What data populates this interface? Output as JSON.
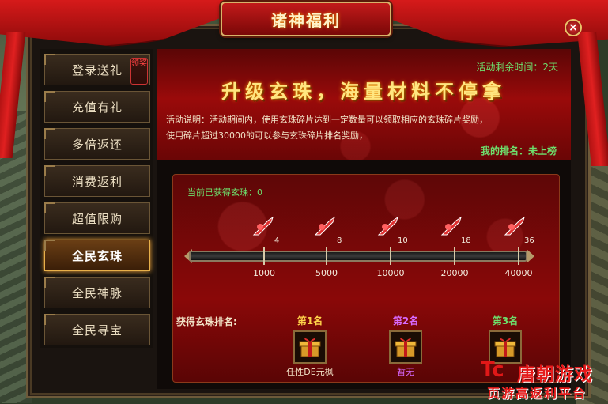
{
  "window": {
    "title": "诸神福利",
    "close_label": "×"
  },
  "sidebar": {
    "items": [
      {
        "label": "登录送礼",
        "badge": "领奖",
        "active": false
      },
      {
        "label": "充值有礼",
        "active": false
      },
      {
        "label": "多倍返还",
        "active": false
      },
      {
        "label": "消费返利",
        "active": false
      },
      {
        "label": "超值限购",
        "active": false
      },
      {
        "label": "全民玄珠",
        "active": true
      },
      {
        "label": "全民神脉",
        "active": false
      },
      {
        "label": "全民寻宝",
        "active": false
      }
    ]
  },
  "banner": {
    "time_left": "活动剩余时间：2天",
    "headline": "升级玄珠，海量材料不停拿",
    "desc_line1": "活动说明：活动期间内，使用玄珠碎片达到一定数量可以领取相应的玄珠碎片奖励，",
    "desc_line2": "使用碎片超过30000的可以参与玄珠碎片排名奖励，",
    "my_rank_label": "我的排名：",
    "my_rank_value": "未上榜"
  },
  "progress": {
    "obtained": "当前已获得玄珠：0",
    "milestones": [
      {
        "threshold": "1000",
        "reward_count": "4"
      },
      {
        "threshold": "5000",
        "reward_count": "8"
      },
      {
        "threshold": "10000",
        "reward_count": "10"
      },
      {
        "threshold": "20000",
        "reward_count": "18"
      },
      {
        "threshold": "40000",
        "reward_count": "36"
      }
    ]
  },
  "ranking": {
    "title": "获得玄珠排名:",
    "slots": [
      {
        "position": "第1名",
        "player": "任性DE元枫",
        "color": "#f2e4c8",
        "pos_color": "#ffd24a"
      },
      {
        "position": "第2名",
        "player": "暂无",
        "color": "#d86aff",
        "pos_color": "#d86aff"
      },
      {
        "position": "第3名",
        "player": "",
        "color": "#6de06d",
        "pos_color": "#6de06d"
      }
    ]
  },
  "watermark": {
    "logo": "Tc",
    "line1": "唐朝游戏",
    "line2": "页游高返利平台"
  }
}
